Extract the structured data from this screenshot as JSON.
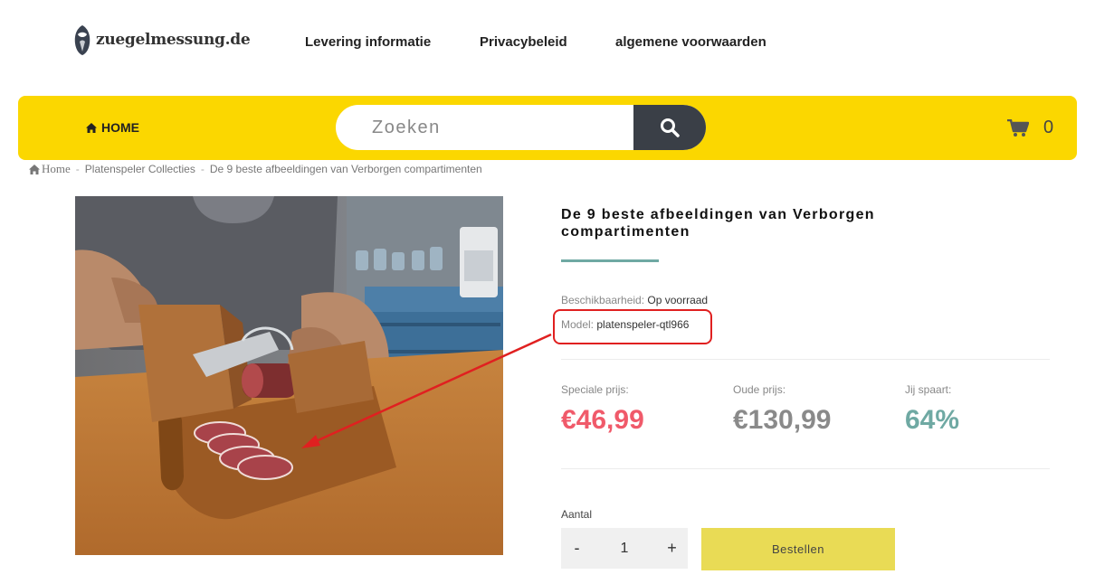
{
  "logo": {
    "text": "zuegelmessung.de",
    "icon": "owl-logo-icon"
  },
  "topnav": {
    "items": [
      "Levering informatie",
      "Privacybeleid",
      "algemene voorwaarden"
    ]
  },
  "bar": {
    "home_label": "HOME",
    "search_placeholder": "Zoeken",
    "cart_count": "0",
    "color": "#fbd700"
  },
  "breadcrumb": {
    "items": [
      "Home",
      "Platenspeler Collecties",
      "De 9 beste afbeeldingen van Verborgen compartimenten"
    ],
    "separator": "-"
  },
  "product": {
    "title": "De 9 beste afbeeldingen van Verborgen compartimenten",
    "availability_label": "Beschikbaarheid:",
    "availability_value": "Op voorraad",
    "model_label": "Model:",
    "model_value": "platenspeler-qtl966",
    "special_label": "Speciale prijs:",
    "special_price": "€46,99",
    "old_label": "Oude prijs:",
    "old_price": "€130,99",
    "save_label": "Jij spaart:",
    "save_value": "64%",
    "qty_label": "Aantal",
    "qty_value": "1",
    "qty_minus": "-",
    "qty_plus": "+",
    "order_label": "Bestellen"
  },
  "colors": {
    "special_price": "#f05a6a",
    "save": "#6fa9a3",
    "order_button": "#e9db55",
    "annotation": "#e02020"
  }
}
